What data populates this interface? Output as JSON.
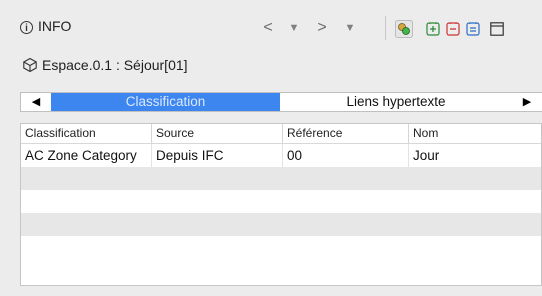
{
  "header": {
    "title": "INFO",
    "info_icon_glyph": "i",
    "nav_back_glyph": "<",
    "nav_back_menu_glyph": "▼",
    "nav_forward_glyph": ">",
    "nav_forward_menu_glyph": "▼"
  },
  "location": {
    "text": "Espace.0.1 : Séjour[01]"
  },
  "tabs": {
    "left_arrow": "◀",
    "right_arrow": "▶",
    "items": [
      {
        "label": "Classification",
        "active": true
      },
      {
        "label": "Liens hypertexte",
        "active": false
      }
    ]
  },
  "table": {
    "columns": [
      "Classification",
      "Source",
      "Référence",
      "Nom"
    ],
    "rows": [
      [
        "AC Zone Category",
        "Depuis IFC",
        "00",
        "Jour"
      ]
    ]
  },
  "colors": {
    "active_tab": "#3d86f0",
    "panel_bg": "#ececec",
    "alt_row": "#e7e7e7"
  }
}
